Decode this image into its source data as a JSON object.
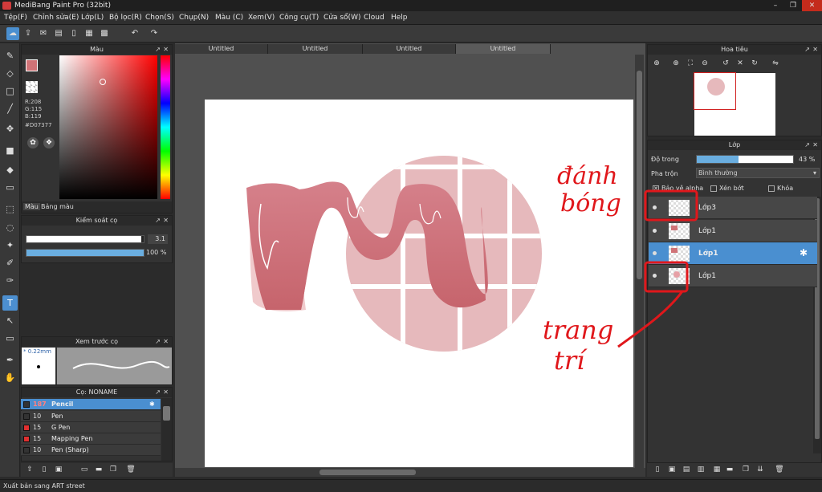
{
  "window": {
    "title": "MediBang Paint Pro (32bit)",
    "controls": [
      "–",
      "❐",
      "✕"
    ]
  },
  "menu": [
    "Tệp(F)",
    "Chỉnh sửa(E)",
    "Lớp(L)",
    "Bộ lọc(R)",
    "Chọn(S)",
    "Chụp(N)",
    "Màu (C)",
    "Xem(V)",
    "Công cụ(T)",
    "Cửa sổ(W)",
    "Cloud",
    "Help"
  ],
  "toolbar": {
    "icons": [
      "cloud-icon",
      "upload-icon",
      "chat-icon",
      "comment-icon",
      "page-icon",
      "grid-icon",
      "grid-edit-icon",
      "undo-icon",
      "redo-icon"
    ]
  },
  "color_panel": {
    "title": "Màu",
    "r": "R:208",
    "g": "G:115",
    "b": "B:119",
    "hex": "#D07377",
    "current_color": "#d07377",
    "tabs": [
      "Màu",
      "Bảng màu"
    ]
  },
  "brush_control": {
    "title": "Kiểm soát cọ",
    "size_value": "3.1",
    "opacity_value": "100 %",
    "size_fill": 0.98,
    "opacity_fill": 1.0
  },
  "brush_preview": {
    "title": "Xem trước cọ",
    "size_label": "* 0.22mm"
  },
  "brush_list": {
    "title": "Cọ: NONAME",
    "items": [
      {
        "size": "187",
        "name": "Pencil",
        "color": "#333333",
        "selected": true
      },
      {
        "size": "10",
        "name": "Pen",
        "color": "#333333",
        "selected": false
      },
      {
        "size": "15",
        "name": "G Pen",
        "color": "#e03030",
        "selected": false
      },
      {
        "size": "15",
        "name": "Mapping Pen",
        "color": "#e03030",
        "selected": false
      },
      {
        "size": "10",
        "name": "Pen (Sharp)",
        "color": "#333333",
        "selected": false
      }
    ]
  },
  "doc_tabs": [
    "Untitled",
    "Untitled",
    "Untitled",
    "Untitled"
  ],
  "navigator": {
    "title": "Hoa tiêu"
  },
  "layers": {
    "title": "Lớp",
    "opacity_label": "Độ trong",
    "opacity_value": "43 %",
    "opacity_fill": 0.43,
    "blend_label": "Pha trộn",
    "blend_value": "Bình thường",
    "protect_alpha": "Bảo vệ alpha",
    "clipping": "Xén bớt",
    "lock": "Khóa",
    "items": [
      {
        "name": "Lớp3",
        "selected": false
      },
      {
        "name": "Lớp1",
        "selected": false
      },
      {
        "name": "Lớp1",
        "selected": true
      },
      {
        "name": "Lớp1",
        "selected": false
      }
    ]
  },
  "annotations": {
    "top": [
      "đánh",
      "bóng"
    ],
    "bottom": [
      "trang",
      "trí"
    ]
  },
  "statusbar": {
    "text": "Xuất bản sang ART street"
  }
}
